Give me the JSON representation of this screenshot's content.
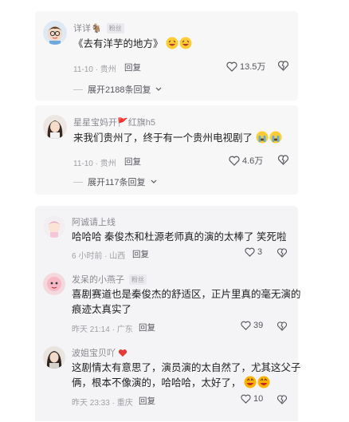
{
  "comments": [
    {
      "username": "详详🐐",
      "badge": "粉丝",
      "text": "《去有洋芋的地方》",
      "meta": "11-10 · 贵州",
      "reply_label": "回复",
      "likes": "13.5万",
      "expand_label": "展开2188条回复",
      "icon": "heart-icon"
    },
    {
      "username": "星星宝妈开🚩红旗h5",
      "badge": "",
      "text": "来我们贵州了，终于有一个贵州电视剧了",
      "meta": "11-10 · 贵州",
      "reply_label": "回复",
      "likes": "4.6万",
      "expand_label": "展开117条回复",
      "icon": "heart-icon"
    },
    {
      "username": "阿诚请上线",
      "badge": "",
      "text": "哈哈哈  秦俊杰和杜源老师真的演的太棒了  笑死啦",
      "meta": "6 小时前 · 山西",
      "reply_label": "回复",
      "likes": "3"
    },
    {
      "username": "发呆的小燕子",
      "badge": "粉丝",
      "text_line1": "喜剧赛道也是秦俊杰的舒适区，正片里真的毫无演的",
      "text_line2": "痕迹太真实了",
      "meta": "昨天 21:14 · 广东",
      "reply_label": "回复",
      "likes": "39"
    },
    {
      "username": "波姐宝贝吖",
      "badge": "",
      "text_line1": "这剧情太有意思了，演员演的太自然了，尤其这父子",
      "text_line2": "俩，根本不像演的，哈哈哈，太好了，",
      "meta": "昨天 23:33 · 重庆",
      "reply_label": "回复",
      "likes": "10"
    }
  ],
  "colors": {
    "text": "#1f1f1f",
    "meta": "#a0a0a6",
    "card_bg": "#f7f7f8",
    "flag_red": "#e53935"
  }
}
